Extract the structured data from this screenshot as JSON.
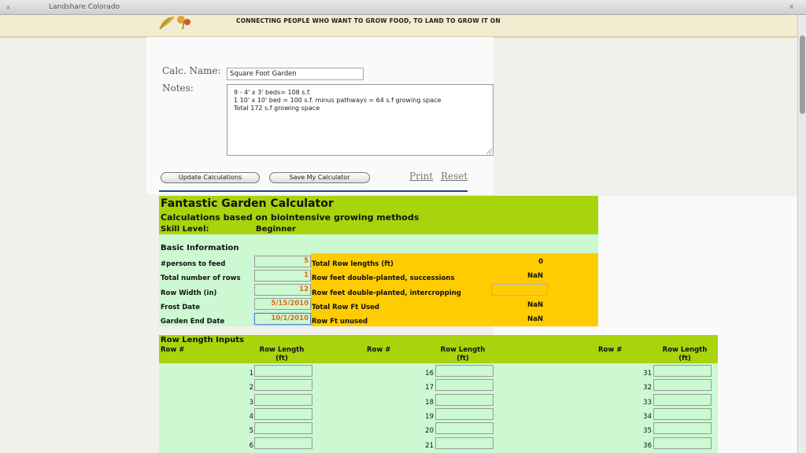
{
  "window": {
    "title": "Landshare Colorado",
    "close_glyph": "x"
  },
  "header": {
    "tagline": "CONNECTING PEOPLE WHO WANT TO GROW FOOD, TO LAND TO GROW IT ON"
  },
  "form": {
    "calc_name_label": "Calc. Name:",
    "calc_name_value": "Square Foot Garden",
    "notes_label": "Notes:",
    "notes_lines": [
      "9 - 4' x 3' beds= 108 s.f.",
      "1 10' x 10' bed = 100 s.f. minus pathways = 64 s.f growing space",
      "Total 172 s.f growing space"
    ]
  },
  "actions": {
    "update_label": "Update Calculations",
    "save_label": "Save My Calculator",
    "print_label": "Print",
    "reset_label": "Reset"
  },
  "calculator": {
    "title": "Fantastic Garden Calculator",
    "subtitle": "Calculations based on biointensive growing methods",
    "skill_label": "Skill Level:",
    "skill_value": "Beginner",
    "basic_title": "Basic Information",
    "inputs": [
      {
        "label": "#persons to feed",
        "value": "5"
      },
      {
        "label": "Total number of rows",
        "value": "1"
      },
      {
        "label": "Row Width (in)",
        "value": "12"
      },
      {
        "label": "Frost Date",
        "value": "5/15/2010"
      },
      {
        "label": "Garden End Date",
        "value": "10/1/2010"
      }
    ],
    "results": [
      {
        "label": "Total Row lengths (ft)",
        "value": "0"
      },
      {
        "label": "Row feet double-planted, successions",
        "value": "NaN"
      },
      {
        "label": "Row feet double-planted, intercropping",
        "value": ""
      },
      {
        "label": "Total Row Ft Used",
        "value": "NaN"
      },
      {
        "label": "Row Ft unused",
        "value": "NaN"
      }
    ]
  },
  "row_length": {
    "title": "Row Length Inputs",
    "row_header": "Row #",
    "length_header_l1": "Row Length",
    "length_header_l2": "(ft)",
    "columns": [
      [
        "1",
        "2",
        "3",
        "4",
        "5",
        "6"
      ],
      [
        "16",
        "17",
        "18",
        "19",
        "20",
        "21"
      ],
      [
        "31",
        "32",
        "33",
        "34",
        "35",
        "36"
      ]
    ]
  },
  "colors": {
    "header_green": "#a8d40c",
    "mint": "#ccf8d2",
    "orange": "#fecc00",
    "value_orange": "#e06a10",
    "divider_blue": "#2b3f8c"
  }
}
